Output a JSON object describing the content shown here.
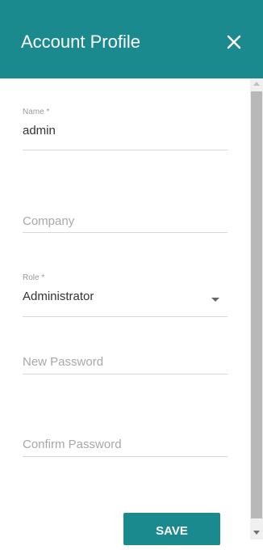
{
  "header": {
    "title": "Account Profile",
    "close_icon": "close-icon",
    "background_color": "#1a8a8e"
  },
  "form": {
    "name": {
      "label": "Name *",
      "value": "admin"
    },
    "company": {
      "placeholder": "Company"
    },
    "role": {
      "label": "Role *",
      "value": "Administrator",
      "arrow_icon": "dropdown-arrow-icon"
    },
    "new_password": {
      "placeholder": "New Password"
    },
    "confirm_password": {
      "placeholder": "Confirm Password"
    }
  },
  "actions": {
    "save_label": "SAVE",
    "accent_color": "#1a8a8e"
  }
}
